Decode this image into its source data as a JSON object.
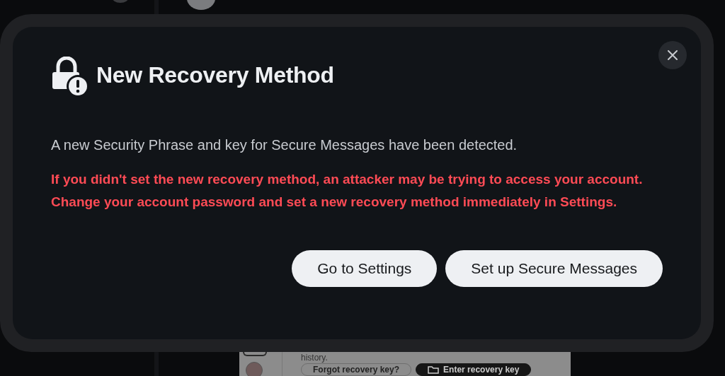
{
  "background_dialog": {
    "text": "history.",
    "buttons": [
      {
        "label": "Forgot recovery key?",
        "kind": "secondary"
      },
      {
        "label": "Enter recovery key",
        "kind": "primary"
      }
    ]
  },
  "dialog": {
    "title": "New Recovery Method",
    "description": "A new Security Phrase and key for Secure Messages have been detected.",
    "warning": "If you didn't set the new recovery method, an attacker may be trying to access your account. Change your account password and set a new recovery method immediately in Settings.",
    "buttons": [
      {
        "label": "Go to Settings"
      },
      {
        "label": "Set up Secure Messages"
      }
    ]
  }
}
